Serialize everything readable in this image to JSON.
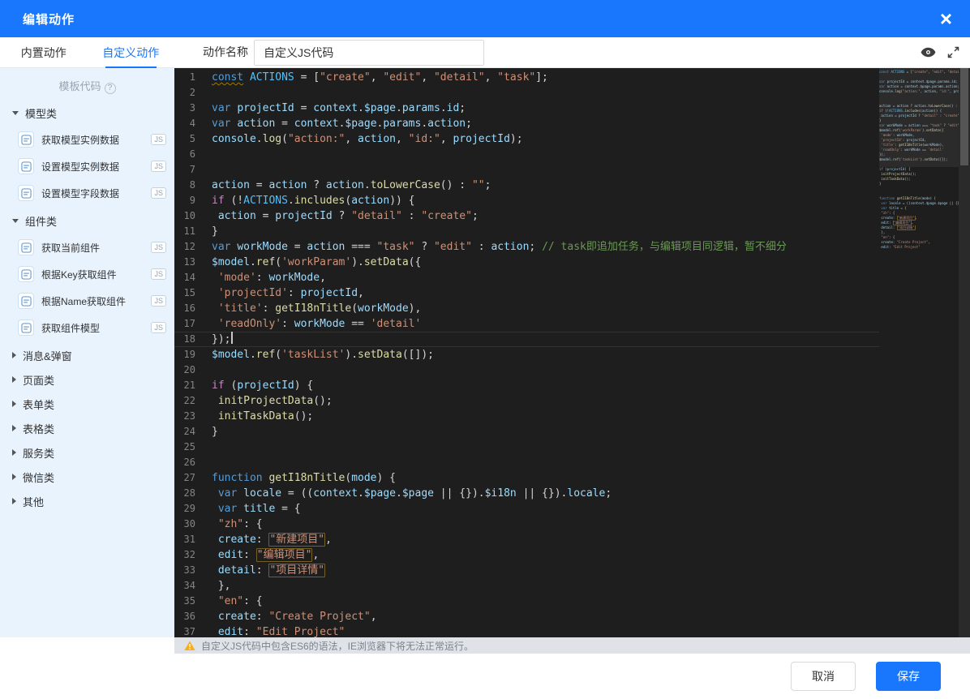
{
  "modal": {
    "title": "编辑动作"
  },
  "icons": {
    "close": "×",
    "help": "?"
  },
  "tabs": {
    "builtin": "内置动作",
    "custom": "自定义动作"
  },
  "action_name": {
    "label": "动作名称",
    "value": "自定义JS代码"
  },
  "sidebar": {
    "template_code": "模板代码",
    "groups": [
      {
        "label": "模型类",
        "expanded": true,
        "items": [
          {
            "label": "获取模型实例数据",
            "badge": "JS"
          },
          {
            "label": "设置模型实例数据",
            "badge": "JS"
          },
          {
            "label": "设置模型字段数据",
            "badge": "JS"
          }
        ]
      },
      {
        "label": "组件类",
        "expanded": true,
        "items": [
          {
            "label": "获取当前组件",
            "badge": "JS"
          },
          {
            "label": "根据Key获取组件",
            "badge": "JS"
          },
          {
            "label": "根据Name获取组件",
            "badge": "JS"
          },
          {
            "label": "获取组件模型",
            "badge": "JS"
          }
        ]
      },
      {
        "label": "消息&弹窗",
        "expanded": false,
        "items": []
      },
      {
        "label": "页面类",
        "expanded": false,
        "items": []
      },
      {
        "label": "表单类",
        "expanded": false,
        "items": []
      },
      {
        "label": "表格类",
        "expanded": false,
        "items": []
      },
      {
        "label": "服务类",
        "expanded": false,
        "items": []
      },
      {
        "label": "微信类",
        "expanded": false,
        "items": []
      },
      {
        "label": "其他",
        "expanded": false,
        "items": []
      }
    ]
  },
  "editor": {
    "cursor_line": 18,
    "lines": [
      {
        "n": 1,
        "t": [
          [
            "ku",
            "const"
          ],
          [
            "p",
            " "
          ],
          [
            "c",
            "ACTIONS"
          ],
          [
            "p",
            " = ["
          ],
          [
            "s",
            "\"create\""
          ],
          [
            "p",
            ", "
          ],
          [
            "s",
            "\"edit\""
          ],
          [
            "p",
            ", "
          ],
          [
            "s",
            "\"detail\""
          ],
          [
            "p",
            ", "
          ],
          [
            "s",
            "\"task\""
          ],
          [
            "p",
            "];"
          ]
        ]
      },
      {
        "n": 2,
        "t": []
      },
      {
        "n": 3,
        "t": [
          [
            "k",
            "var"
          ],
          [
            "p",
            " "
          ],
          [
            "v",
            "projectId"
          ],
          [
            "p",
            " = "
          ],
          [
            "v",
            "context"
          ],
          [
            "p",
            "."
          ],
          [
            "v",
            "$page"
          ],
          [
            "p",
            "."
          ],
          [
            "v",
            "params"
          ],
          [
            "p",
            "."
          ],
          [
            "v",
            "id"
          ],
          [
            "p",
            ";"
          ]
        ]
      },
      {
        "n": 4,
        "t": [
          [
            "k",
            "var"
          ],
          [
            "p",
            " "
          ],
          [
            "v",
            "action"
          ],
          [
            "p",
            " = "
          ],
          [
            "v",
            "context"
          ],
          [
            "p",
            "."
          ],
          [
            "v",
            "$page"
          ],
          [
            "p",
            "."
          ],
          [
            "v",
            "params"
          ],
          [
            "p",
            "."
          ],
          [
            "v",
            "action"
          ],
          [
            "p",
            ";"
          ]
        ]
      },
      {
        "n": 5,
        "t": [
          [
            "v",
            "console"
          ],
          [
            "p",
            "."
          ],
          [
            "f",
            "log"
          ],
          [
            "p",
            "("
          ],
          [
            "s",
            "\"action:\""
          ],
          [
            "p",
            ", "
          ],
          [
            "v",
            "action"
          ],
          [
            "p",
            ", "
          ],
          [
            "s",
            "\"id:\""
          ],
          [
            "p",
            ", "
          ],
          [
            "v",
            "projectId"
          ],
          [
            "p",
            ");"
          ]
        ]
      },
      {
        "n": 6,
        "t": []
      },
      {
        "n": 7,
        "t": []
      },
      {
        "n": 8,
        "t": [
          [
            "v",
            "action"
          ],
          [
            "p",
            " = "
          ],
          [
            "v",
            "action"
          ],
          [
            "p",
            " ? "
          ],
          [
            "v",
            "action"
          ],
          [
            "p",
            "."
          ],
          [
            "f",
            "toLowerCase"
          ],
          [
            "p",
            "() : "
          ],
          [
            "s",
            "\"\""
          ],
          [
            "p",
            ";"
          ]
        ]
      },
      {
        "n": 9,
        "t": [
          [
            "ctl",
            "if"
          ],
          [
            "p",
            " (!"
          ],
          [
            "c",
            "ACTIONS"
          ],
          [
            "p",
            "."
          ],
          [
            "f",
            "includes"
          ],
          [
            "p",
            "("
          ],
          [
            "v",
            "action"
          ],
          [
            "p",
            ")) {"
          ]
        ]
      },
      {
        "n": 10,
        "t": [
          [
            "p",
            " "
          ],
          [
            "v",
            "action"
          ],
          [
            "p",
            " = "
          ],
          [
            "v",
            "projectId"
          ],
          [
            "p",
            " ? "
          ],
          [
            "s",
            "\"detail\""
          ],
          [
            "p",
            " : "
          ],
          [
            "s",
            "\"create\""
          ],
          [
            "p",
            ";"
          ]
        ]
      },
      {
        "n": 11,
        "t": [
          [
            "p",
            "}"
          ]
        ]
      },
      {
        "n": 12,
        "t": [
          [
            "k",
            "var"
          ],
          [
            "p",
            " "
          ],
          [
            "v",
            "workMode"
          ],
          [
            "p",
            " = "
          ],
          [
            "v",
            "action"
          ],
          [
            "p",
            " === "
          ],
          [
            "s",
            "\"task\""
          ],
          [
            "p",
            " ? "
          ],
          [
            "s",
            "\"edit\""
          ],
          [
            "p",
            " : "
          ],
          [
            "v",
            "action"
          ],
          [
            "p",
            "; "
          ],
          [
            "cm",
            "// task即追加任务，与编辑项目同逻辑，暂不细分"
          ]
        ]
      },
      {
        "n": 13,
        "t": [
          [
            "v",
            "$model"
          ],
          [
            "p",
            "."
          ],
          [
            "f",
            "ref"
          ],
          [
            "p",
            "("
          ],
          [
            "s",
            "'workParam'"
          ],
          [
            "p",
            ")."
          ],
          [
            "f",
            "setData"
          ],
          [
            "p",
            "({"
          ]
        ]
      },
      {
        "n": 14,
        "t": [
          [
            "p",
            " "
          ],
          [
            "s",
            "'mode'"
          ],
          [
            "p",
            ": "
          ],
          [
            "v",
            "workMode"
          ],
          [
            "p",
            ","
          ]
        ]
      },
      {
        "n": 15,
        "t": [
          [
            "p",
            " "
          ],
          [
            "s",
            "'projectId'"
          ],
          [
            "p",
            ": "
          ],
          [
            "v",
            "projectId"
          ],
          [
            "p",
            ","
          ]
        ]
      },
      {
        "n": 16,
        "t": [
          [
            "p",
            " "
          ],
          [
            "s",
            "'title'"
          ],
          [
            "p",
            ": "
          ],
          [
            "f",
            "getI18nTitle"
          ],
          [
            "p",
            "("
          ],
          [
            "v",
            "workMode"
          ],
          [
            "p",
            "),"
          ]
        ]
      },
      {
        "n": 17,
        "t": [
          [
            "p",
            " "
          ],
          [
            "s",
            "'readOnly'"
          ],
          [
            "p",
            ": "
          ],
          [
            "v",
            "workMode"
          ],
          [
            "p",
            " == "
          ],
          [
            "s",
            "'detail'"
          ]
        ]
      },
      {
        "n": 18,
        "t": [
          [
            "p",
            "});"
          ]
        ]
      },
      {
        "n": 19,
        "t": [
          [
            "v",
            "$model"
          ],
          [
            "p",
            "."
          ],
          [
            "f",
            "ref"
          ],
          [
            "p",
            "("
          ],
          [
            "s",
            "'taskList'"
          ],
          [
            "p",
            ")."
          ],
          [
            "f",
            "setData"
          ],
          [
            "p",
            "([]);"
          ]
        ]
      },
      {
        "n": 20,
        "t": []
      },
      {
        "n": 21,
        "t": [
          [
            "ctl",
            "if"
          ],
          [
            "p",
            " ("
          ],
          [
            "v",
            "projectId"
          ],
          [
            "p",
            ") {"
          ]
        ]
      },
      {
        "n": 22,
        "t": [
          [
            "p",
            " "
          ],
          [
            "f",
            "initProjectData"
          ],
          [
            "p",
            "();"
          ]
        ]
      },
      {
        "n": 23,
        "t": [
          [
            "p",
            " "
          ],
          [
            "f",
            "initTaskData"
          ],
          [
            "p",
            "();"
          ]
        ]
      },
      {
        "n": 24,
        "t": [
          [
            "p",
            "}"
          ]
        ]
      },
      {
        "n": 25,
        "t": []
      },
      {
        "n": 26,
        "t": []
      },
      {
        "n": 27,
        "t": [
          [
            "k",
            "function"
          ],
          [
            "p",
            " "
          ],
          [
            "f",
            "getI18nTitle"
          ],
          [
            "p",
            "("
          ],
          [
            "v",
            "mode"
          ],
          [
            "p",
            ") {"
          ]
        ]
      },
      {
        "n": 28,
        "t": [
          [
            "p",
            " "
          ],
          [
            "k",
            "var"
          ],
          [
            "p",
            " "
          ],
          [
            "v",
            "locale"
          ],
          [
            "p",
            " = (("
          ],
          [
            "v",
            "context"
          ],
          [
            "p",
            "."
          ],
          [
            "v",
            "$page"
          ],
          [
            "p",
            "."
          ],
          [
            "v",
            "$page"
          ],
          [
            "p",
            " || {})."
          ],
          [
            "v",
            "$i18n"
          ],
          [
            "p",
            " || {})."
          ],
          [
            "v",
            "locale"
          ],
          [
            "p",
            ";"
          ]
        ]
      },
      {
        "n": 29,
        "t": [
          [
            "p",
            " "
          ],
          [
            "k",
            "var"
          ],
          [
            "p",
            " "
          ],
          [
            "v",
            "title"
          ],
          [
            "p",
            " = {"
          ]
        ]
      },
      {
        "n": 30,
        "t": [
          [
            "p",
            " "
          ],
          [
            "s",
            "\"zh\""
          ],
          [
            "p",
            ": {"
          ]
        ]
      },
      {
        "n": 31,
        "t": [
          [
            "p",
            " "
          ],
          [
            "v",
            "create"
          ],
          [
            "p",
            ": "
          ],
          [
            "su",
            "\"新建项目\""
          ],
          [
            "p",
            ","
          ]
        ]
      },
      {
        "n": 32,
        "t": [
          [
            "p",
            " "
          ],
          [
            "v",
            "edit"
          ],
          [
            "p",
            ": "
          ],
          [
            "su",
            "\"编辑项目\""
          ],
          [
            "p",
            ","
          ]
        ]
      },
      {
        "n": 33,
        "t": [
          [
            "p",
            " "
          ],
          [
            "v",
            "detail"
          ],
          [
            "p",
            ": "
          ],
          [
            "su",
            "\"项目详情\""
          ]
        ]
      },
      {
        "n": 34,
        "t": [
          [
            "p",
            " },"
          ]
        ]
      },
      {
        "n": 35,
        "t": [
          [
            "p",
            " "
          ],
          [
            "s",
            "\"en\""
          ],
          [
            "p",
            ": {"
          ]
        ]
      },
      {
        "n": 36,
        "t": [
          [
            "p",
            " "
          ],
          [
            "v",
            "create"
          ],
          [
            "p",
            ": "
          ],
          [
            "s",
            "\"Create Project\""
          ],
          [
            "p",
            ","
          ]
        ]
      },
      {
        "n": 37,
        "t": [
          [
            "p",
            " "
          ],
          [
            "v",
            "edit"
          ],
          [
            "p",
            ": "
          ],
          [
            "s",
            "\"Edit Project\""
          ]
        ]
      }
    ]
  },
  "warning": {
    "text": "自定义JS代码中包含ES6的语法，IE浏览器下将无法正常运行。"
  },
  "footer": {
    "cancel": "取消",
    "save": "保存"
  }
}
